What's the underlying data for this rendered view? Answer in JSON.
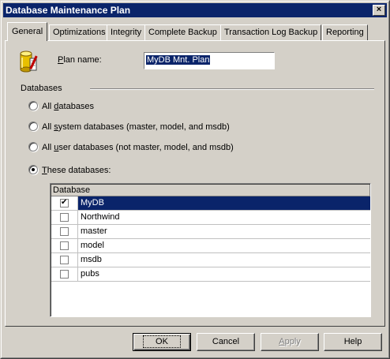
{
  "window": {
    "title": "Database Maintenance Plan",
    "close_glyph": "×"
  },
  "tabs": [
    {
      "label": "General"
    },
    {
      "label": "Optimizations"
    },
    {
      "label": "Integrity"
    },
    {
      "label": "Complete Backup"
    },
    {
      "label": "Transaction Log Backup"
    },
    {
      "label": "Reporting"
    }
  ],
  "general": {
    "plan_name_label": "Plan name:",
    "plan_name_value": "MyDB Mnt. Plan",
    "databases_group_label": "Databases",
    "radios": [
      {
        "label": "All databases",
        "checked": false
      },
      {
        "label": "All system databases (master, model, and msdb)",
        "checked": false
      },
      {
        "label": "All user databases (not master, model, and msdb)",
        "checked": false
      },
      {
        "label": "These databases:",
        "checked": true
      }
    ],
    "grid": {
      "column_header": "Database",
      "rows": [
        {
          "name": "MyDB",
          "checked": true,
          "selected": true
        },
        {
          "name": "Northwind",
          "checked": false,
          "selected": false
        },
        {
          "name": "master",
          "checked": false,
          "selected": false
        },
        {
          "name": "model",
          "checked": false,
          "selected": false
        },
        {
          "name": "msdb",
          "checked": false,
          "selected": false
        },
        {
          "name": "pubs",
          "checked": false,
          "selected": false
        }
      ]
    }
  },
  "buttons": {
    "ok": "OK",
    "cancel": "Cancel",
    "apply": "Apply",
    "help": "Help"
  },
  "icons": {
    "close": "close-icon",
    "database": "database-plan-icon",
    "checkbox": "checkbox-icon",
    "radio": "radio-icon"
  },
  "colors": {
    "face": "#d4d0c8",
    "titlebar": "#0a246a",
    "selection": "#0a246a"
  }
}
